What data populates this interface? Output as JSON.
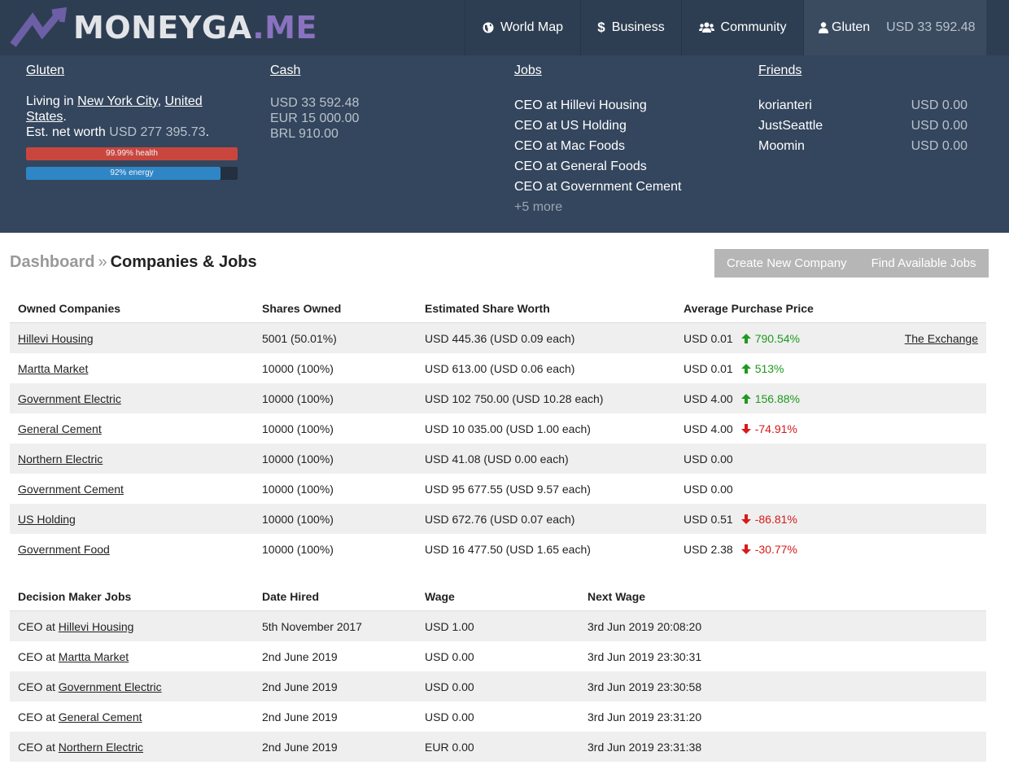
{
  "logo": {
    "text_a": "MONEYGA",
    "text_b": ".ME"
  },
  "nav": {
    "world_map": "World Map",
    "business": "Business",
    "community": "Community",
    "user": "Gluten",
    "balance": "USD 33 592.48"
  },
  "stats": {
    "gluten": {
      "title": "Gluten",
      "living_prefix": "Living in ",
      "city": "New York City",
      "comma": ", ",
      "country": "United States",
      "period": ".",
      "networth_label": "Est. net worth ",
      "networth_value": "USD 277 395.73",
      "networth_end": ".",
      "health_label": "99.99% health",
      "health_pct": 99.99,
      "energy_label": "92% energy",
      "energy_pct": 92
    },
    "cash": {
      "title": "Cash",
      "lines": [
        "USD 33 592.48",
        "EUR 15 000.00",
        "BRL 910.00"
      ]
    },
    "jobs": {
      "title": "Jobs",
      "items": [
        "CEO at Hillevi Housing",
        "CEO at US Holding",
        "CEO at Mac Foods",
        "CEO at General Foods",
        "CEO at Government Cement"
      ],
      "more": "+5 more"
    },
    "friends": {
      "title": "Friends",
      "items": [
        {
          "name": "korianteri",
          "amount": "USD 0.00"
        },
        {
          "name": "JustSeattle",
          "amount": "USD 0.00"
        },
        {
          "name": "Moomin",
          "amount": "USD 0.00"
        }
      ]
    }
  },
  "breadcrumb": {
    "dashboard": "Dashboard",
    "sep": "»",
    "current": "Companies & Jobs"
  },
  "buttons": {
    "create": "Create New Company",
    "find": "Find Available Jobs"
  },
  "colors": {
    "up": "#1e9a1e",
    "down": "#d71a1a",
    "health": "#c9463f",
    "energy": "#2f86c7"
  },
  "owned": {
    "headers": [
      "Owned Companies",
      "Shares Owned",
      "Estimated Share Worth",
      "Average Purchase Price"
    ],
    "rows": [
      {
        "name": "Hillevi Housing",
        "shares": "5001 (50.01%)",
        "worth": "USD 445.36 (USD 0.09 each)",
        "price": "USD 0.01",
        "change": "790.54%",
        "dir": "up",
        "extra": "The Exchange"
      },
      {
        "name": "Martta Market",
        "shares": "10000 (100%)",
        "worth": "USD 613.00 (USD 0.06 each)",
        "price": "USD 0.01",
        "change": "513%",
        "dir": "up"
      },
      {
        "name": "Government Electric",
        "shares": "10000 (100%)",
        "worth": "USD 102 750.00 (USD 10.28 each)",
        "price": "USD 4.00",
        "change": "156.88%",
        "dir": "up"
      },
      {
        "name": "General Cement",
        "shares": "10000 (100%)",
        "worth": "USD 10 035.00 (USD 1.00 each)",
        "price": "USD 4.00",
        "change": "-74.91%",
        "dir": "down"
      },
      {
        "name": "Northern Electric",
        "shares": "10000 (100%)",
        "worth": "USD 41.08 (USD 0.00 each)",
        "price": "USD 0.00"
      },
      {
        "name": "Government Cement",
        "shares": "10000 (100%)",
        "worth": "USD 95 677.55 (USD 9.57 each)",
        "price": "USD 0.00"
      },
      {
        "name": "US Holding",
        "shares": "10000 (100%)",
        "worth": "USD 672.76 (USD 0.07 each)",
        "price": "USD 0.51",
        "change": "-86.81%",
        "dir": "down"
      },
      {
        "name": "Government Food",
        "shares": "10000 (100%)",
        "worth": "USD 16 477.50 (USD 1.65 each)",
        "price": "USD 2.38",
        "change": "-30.77%",
        "dir": "down"
      }
    ]
  },
  "jobs_table": {
    "headers": [
      "Decision Maker Jobs",
      "Date Hired",
      "Wage",
      "Next Wage"
    ],
    "prefix": "CEO at ",
    "rows": [
      {
        "company": "Hillevi Housing",
        "hired": "5th November 2017",
        "wage": "USD 1.00",
        "next": "3rd Jun 2019 20:08:20"
      },
      {
        "company": "Martta Market",
        "hired": "2nd June 2019",
        "wage": "USD 0.00",
        "next": "3rd Jun 2019 23:30:31"
      },
      {
        "company": "Government Electric",
        "hired": "2nd June 2019",
        "wage": "USD 0.00",
        "next": "3rd Jun 2019 23:30:58"
      },
      {
        "company": "General Cement",
        "hired": "2nd June 2019",
        "wage": "USD 0.00",
        "next": "3rd Jun 2019 23:31:20"
      },
      {
        "company": "Northern Electric",
        "hired": "2nd June 2019",
        "wage": "EUR 0.00",
        "next": "3rd Jun 2019 23:31:38"
      }
    ]
  }
}
